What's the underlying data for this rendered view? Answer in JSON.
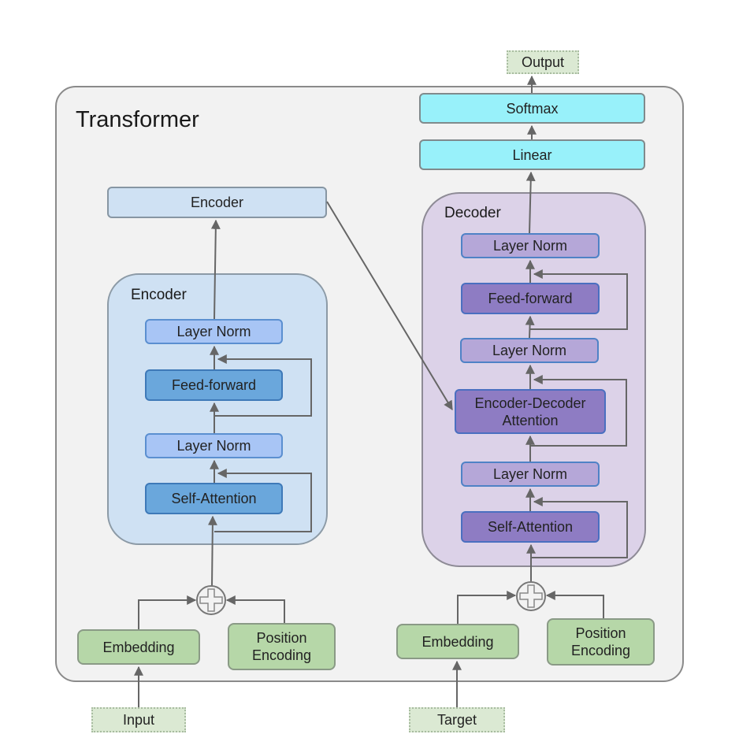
{
  "diagram": {
    "title": "Transformer",
    "io": {
      "output": "Output",
      "input": "Input",
      "target": "Target"
    },
    "head": {
      "softmax": "Softmax",
      "linear": "Linear"
    },
    "encoder_output": "Encoder",
    "encoder": {
      "label": "Encoder",
      "layers": [
        "Layer Norm",
        "Feed-forward",
        "Layer Norm",
        "Self-Attention"
      ]
    },
    "decoder": {
      "label": "Decoder",
      "layers": [
        "Layer Norm",
        "Feed-forward",
        "Layer Norm",
        "Encoder-Decoder Attention",
        "Layer Norm",
        "Self-Attention"
      ]
    },
    "encoder_inputs": {
      "embedding": "Embedding",
      "position_encoding": "Position Encoding"
    },
    "decoder_inputs": {
      "embedding": "Embedding",
      "position_encoding": "Position Encoding"
    },
    "colors": {
      "container_bg": "#f2f2f2",
      "encoder_bg": "#cfe1f3",
      "decoder_bg": "#dcd2e8",
      "head_cyan": "#98f1fa",
      "input_green": "#b6d7a8",
      "io_green": "#dbe9d3",
      "enc_layer_norm": "#a8c5f5",
      "enc_op": "#6aa7dc",
      "dec_layer_norm": "#b5a7d8",
      "dec_op": "#8e7cc3",
      "arrow": "#666666"
    }
  }
}
